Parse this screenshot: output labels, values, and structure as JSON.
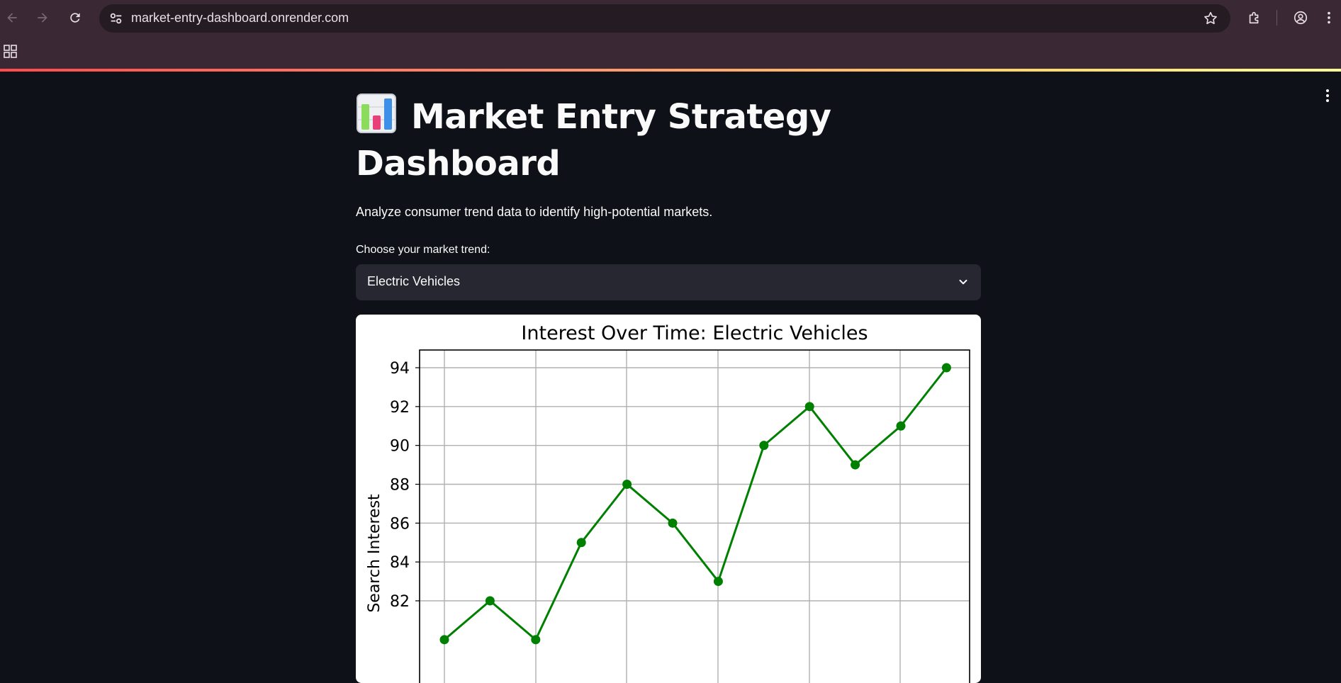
{
  "browser": {
    "url": "market-entry-dashboard.onrender.com"
  },
  "icons": {
    "back": "arrow-left-icon",
    "forward": "arrow-right-icon",
    "reload": "reload-icon",
    "site_settings": "tune-icon",
    "bookmark": "star-icon",
    "extensions": "puzzle-icon",
    "profile": "account-icon",
    "menu": "kebab-menu-icon",
    "apps": "apps-grid-icon",
    "chevron": "chevron-down-icon"
  },
  "app": {
    "title_line1": "Market Entry Strategy",
    "title_line2": "Dashboard",
    "subtitle": "Analyze consumer trend data to identify high-potential markets.",
    "select_label": "Choose your market trend:",
    "select_value": "Electric Vehicles"
  },
  "colors": {
    "background": "#0e1117",
    "line": "#008000",
    "select_bg": "#262730"
  },
  "chart_data": {
    "type": "line",
    "title": "Interest Over Time: Electric Vehicles",
    "ylabel": "Search Interest",
    "xlabel": "",
    "yticks": [
      82,
      84,
      86,
      88,
      90,
      92,
      94
    ],
    "ylim_visible": [
      81.2,
      94.8
    ],
    "grid": true,
    "series": [
      {
        "color": "#008000",
        "marker": "circle",
        "values": [
          80,
          82,
          80,
          85,
          88,
          86,
          83,
          90,
          92,
          89,
          91,
          94
        ]
      }
    ]
  }
}
